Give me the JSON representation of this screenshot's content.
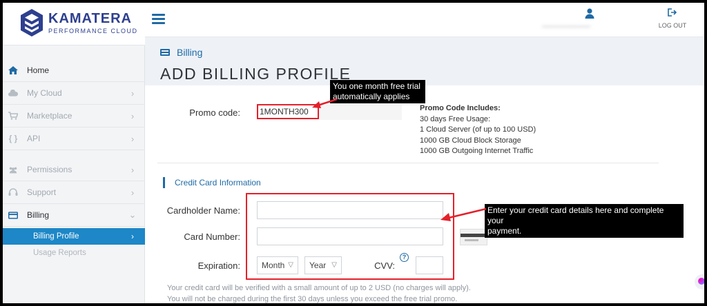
{
  "brand": {
    "name": "KAMATERA",
    "tagline": "PERFORMANCE CLOUD"
  },
  "sidebar": {
    "items": [
      {
        "label": "Home",
        "icon": "home-icon"
      },
      {
        "label": "My Cloud",
        "icon": "cloud-icon"
      },
      {
        "label": "Marketplace",
        "icon": "cart-icon"
      },
      {
        "label": "API",
        "icon": "code-braces-icon"
      },
      {
        "label": "Permissions",
        "icon": "users-icon"
      },
      {
        "label": "Support",
        "icon": "headset-icon"
      },
      {
        "label": "Billing",
        "icon": "credit-card-icon"
      }
    ],
    "subitems": [
      {
        "label": "Billing Profile",
        "active": true
      },
      {
        "label": "Usage Reports",
        "active": false
      }
    ]
  },
  "topbar": {
    "username": "••••••••••••••••••••",
    "logout_label": "LOG OUT"
  },
  "page": {
    "breadcrumb": "Billing",
    "title": "ADD BILLING PROFILE"
  },
  "promo": {
    "label": "Promo code:",
    "value": "1MONTH300",
    "includes_title": "Promo Code Includes:",
    "includes": [
      "30 days Free Usage:",
      "1 Cloud Server (of up to 100 USD)",
      "1000 GB Cloud Block Storage",
      "1000 GB Outgoing Internet Traffic"
    ]
  },
  "credit_card": {
    "section_title": "Credit Card Information",
    "cardholder_label": "Cardholder Name:",
    "cardholder_value": "",
    "card_number_label": "Card Number:",
    "card_number_value": "",
    "expiration_label": "Expiration:",
    "month_selected": "Month",
    "year_selected": "Year",
    "cvv_label": "CVV:",
    "cvv_help": "?",
    "cvv_value": ""
  },
  "notes": [
    "Your credit card will be verified with a small amount of up to 2 USD (no charges will apply).",
    "You will not be charged during the first 30 days unless you exceed the free trial promo."
  ],
  "callouts": {
    "promo": [
      "You one month free trial",
      "automatically applies"
    ],
    "card": [
      "Enter your credit card details here and complete your",
      "payment."
    ]
  },
  "colors": {
    "accent": "#1f6aa5",
    "active_nav": "#1d87c7",
    "annotation_red": "#e3202a",
    "brand": "#2d3f8f"
  }
}
